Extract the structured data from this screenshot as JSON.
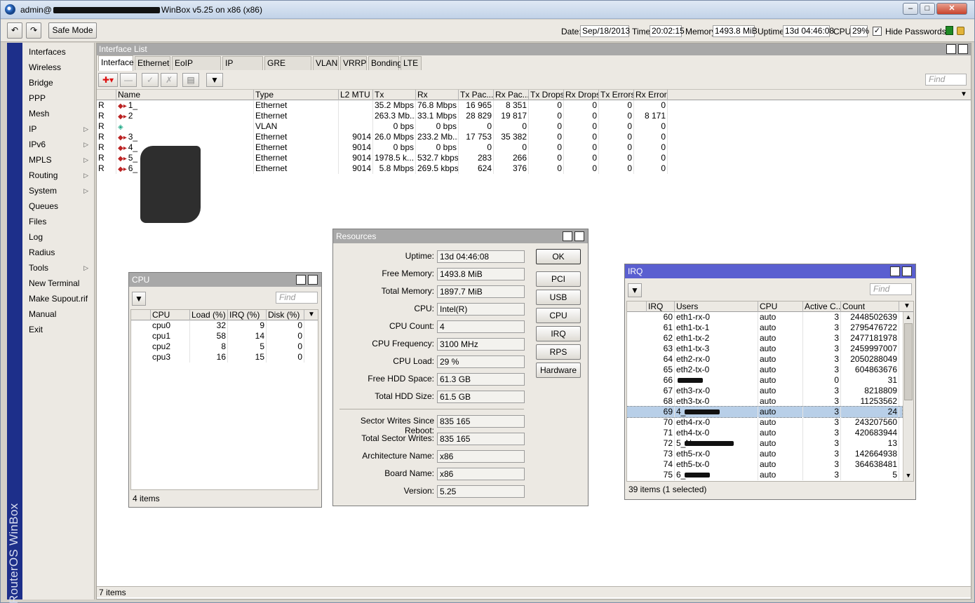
{
  "window": {
    "title_prefix": "admin@",
    "title_suffix": "WinBox v5.25 on x86 (x86)"
  },
  "toolbar": {
    "safe_mode": "Safe Mode",
    "date_label": "Date:",
    "date": "Sep/18/2013",
    "time_label": "Time:",
    "time": "20:02:15",
    "memory_label": "Memory:",
    "memory": "1493.8 MiB",
    "uptime_label": "Uptime:",
    "uptime": "13d 04:46:08",
    "cpu_label": "CPU:",
    "cpu": "29%",
    "hide_passwords": "Hide Passwords"
  },
  "brand": "RouterOS WinBox",
  "menu": [
    {
      "label": "Interfaces",
      "sub": false
    },
    {
      "label": "Wireless",
      "sub": false
    },
    {
      "label": "Bridge",
      "sub": false
    },
    {
      "label": "PPP",
      "sub": false
    },
    {
      "label": "Mesh",
      "sub": false
    },
    {
      "label": "IP",
      "sub": true
    },
    {
      "label": "IPv6",
      "sub": true
    },
    {
      "label": "MPLS",
      "sub": true
    },
    {
      "label": "Routing",
      "sub": true
    },
    {
      "label": "System",
      "sub": true
    },
    {
      "label": "Queues",
      "sub": false
    },
    {
      "label": "Files",
      "sub": false
    },
    {
      "label": "Log",
      "sub": false
    },
    {
      "label": "Radius",
      "sub": false
    },
    {
      "label": "Tools",
      "sub": true
    },
    {
      "label": "New Terminal",
      "sub": false
    },
    {
      "label": "Make Supout.rif",
      "sub": false
    },
    {
      "label": "Manual",
      "sub": false
    },
    {
      "label": "Exit",
      "sub": false
    }
  ],
  "interface_list": {
    "title": "Interface List",
    "tabs": [
      "Interface",
      "Ethernet",
      "EoIP Tunnel",
      "IP Tunnel",
      "GRE Tunnel",
      "VLAN",
      "VRRP",
      "Bonding",
      "LTE"
    ],
    "find": "Find",
    "columns": [
      "Name",
      "Type",
      "L2 MTU",
      "Tx",
      "Rx",
      "Tx Pac...",
      "Rx Pac...",
      "Tx Drops",
      "Rx Drops",
      "Tx Errors",
      "Rx Errors"
    ],
    "rows": [
      {
        "flag": "R",
        "name": "1_",
        "type": "Ethernet",
        "mtu": "",
        "tx": "35.2 Mbps",
        "rx": "76.8 Mbps",
        "txp": "16 965",
        "rxp": "8 351",
        "txd": "0",
        "rxd": "0",
        "txe": "0",
        "rxe": "0"
      },
      {
        "flag": "R",
        "name": "2",
        "type": "Ethernet",
        "mtu": "",
        "tx": "263.3 Mb...",
        "rx": "33.1 Mbps",
        "txp": "28 829",
        "rxp": "19 817",
        "txd": "0",
        "rxd": "0",
        "txe": "0",
        "rxe": "8 171"
      },
      {
        "flag": "R",
        "name": "",
        "type": "VLAN",
        "mtu": "",
        "tx": "0 bps",
        "rx": "0 bps",
        "txp": "0",
        "rxp": "0",
        "txd": "0",
        "rxd": "0",
        "txe": "0",
        "rxe": "0"
      },
      {
        "flag": "R",
        "name": "3_",
        "type": "Ethernet",
        "mtu": "9014",
        "tx": "26.0 Mbps",
        "rx": "233.2 Mb...",
        "txp": "17 753",
        "rxp": "35 382",
        "txd": "0",
        "rxd": "0",
        "txe": "0",
        "rxe": "0"
      },
      {
        "flag": "R",
        "name": "4_",
        "type": "Ethernet",
        "mtu": "9014",
        "tx": "0 bps",
        "rx": "0 bps",
        "txp": "0",
        "rxp": "0",
        "txd": "0",
        "rxd": "0",
        "txe": "0",
        "rxe": "0"
      },
      {
        "flag": "R",
        "name": "5_",
        "type": "Ethernet",
        "mtu": "9014",
        "tx": "1978.5 k...",
        "rx": "532.7 kbps",
        "txp": "283",
        "rxp": "266",
        "txd": "0",
        "rxd": "0",
        "txe": "0",
        "rxe": "0"
      },
      {
        "flag": "R",
        "name": "6_",
        "type": "Ethernet",
        "mtu": "9014",
        "tx": "5.8 Mbps",
        "rx": "269.5 kbps",
        "txp": "624",
        "rxp": "376",
        "txd": "0",
        "rxd": "0",
        "txe": "0",
        "rxe": "0"
      }
    ],
    "status": "7 items"
  },
  "cpu_window": {
    "title": "CPU",
    "find": "Find",
    "columns": [
      "CPU",
      "Load (%)",
      "IRQ (%)",
      "Disk (%)"
    ],
    "rows": [
      {
        "cpu": "cpu0",
        "load": "32",
        "irq": "9",
        "disk": "0"
      },
      {
        "cpu": "cpu1",
        "load": "58",
        "irq": "14",
        "disk": "0"
      },
      {
        "cpu": "cpu2",
        "load": "8",
        "irq": "5",
        "disk": "0"
      },
      {
        "cpu": "cpu3",
        "load": "16",
        "irq": "15",
        "disk": "0"
      }
    ],
    "status": "4 items"
  },
  "resources": {
    "title": "Resources",
    "fields": [
      {
        "label": "Uptime:",
        "value": "13d 04:46:08"
      },
      {
        "label": "Free Memory:",
        "value": "1493.8 MiB"
      },
      {
        "label": "Total Memory:",
        "value": "1897.7 MiB"
      },
      {
        "label": "CPU:",
        "value": "Intel(R)"
      },
      {
        "label": "CPU Count:",
        "value": "4"
      },
      {
        "label": "CPU Frequency:",
        "value": "3100 MHz"
      },
      {
        "label": "CPU Load:",
        "value": "29 %"
      },
      {
        "label": "Free HDD Space:",
        "value": "61.3 GB"
      },
      {
        "label": "Total HDD Size:",
        "value": "61.5 GB"
      },
      {
        "label": "Sector Writes Since Reboot:",
        "value": "835 165"
      },
      {
        "label": "Total Sector Writes:",
        "value": "835 165"
      },
      {
        "label": "Architecture Name:",
        "value": "x86"
      },
      {
        "label": "Board Name:",
        "value": "x86"
      },
      {
        "label": "Version:",
        "value": "5.25"
      }
    ],
    "buttons": [
      "OK",
      "PCI",
      "USB",
      "CPU",
      "IRQ",
      "RPS",
      "Hardware"
    ]
  },
  "irq_window": {
    "title": "IRQ",
    "find": "Find",
    "columns": [
      "IRQ",
      "Users",
      "CPU",
      "Active C...",
      "Count"
    ],
    "rows": [
      {
        "irq": "60",
        "users": "eth1-rx-0",
        "cpu": "auto",
        "active": "3",
        "count": "2448502639"
      },
      {
        "irq": "61",
        "users": "eth1-tx-1",
        "cpu": "auto",
        "active": "3",
        "count": "2795476722"
      },
      {
        "irq": "62",
        "users": "eth1-tx-2",
        "cpu": "auto",
        "active": "3",
        "count": "2477181978"
      },
      {
        "irq": "63",
        "users": "eth1-tx-3",
        "cpu": "auto",
        "active": "3",
        "count": "2459997007"
      },
      {
        "irq": "64",
        "users": "eth2-rx-0",
        "cpu": "auto",
        "active": "3",
        "count": "2050288049"
      },
      {
        "irq": "65",
        "users": "eth2-tx-0",
        "cpu": "auto",
        "active": "3",
        "count": "604863676"
      },
      {
        "irq": "66",
        "users": "",
        "cpu": "auto",
        "active": "0",
        "count": "31"
      },
      {
        "irq": "67",
        "users": "eth3-rx-0",
        "cpu": "auto",
        "active": "3",
        "count": "8218809"
      },
      {
        "irq": "68",
        "users": "eth3-tx-0",
        "cpu": "auto",
        "active": "3",
        "count": "11253562"
      },
      {
        "irq": "69",
        "users": "4_",
        "cpu": "auto",
        "active": "3",
        "count": "24"
      },
      {
        "irq": "70",
        "users": "eth4-rx-0",
        "cpu": "auto",
        "active": "3",
        "count": "243207560"
      },
      {
        "irq": "71",
        "users": "eth4-tx-0",
        "cpu": "auto",
        "active": "3",
        "count": "420683944"
      },
      {
        "irq": "72",
        "users": "5_N",
        "cpu": "auto",
        "active": "3",
        "count": "13"
      },
      {
        "irq": "73",
        "users": "eth5-rx-0",
        "cpu": "auto",
        "active": "3",
        "count": "142664938"
      },
      {
        "irq": "74",
        "users": "eth5-tx-0",
        "cpu": "auto",
        "active": "3",
        "count": "364638481"
      },
      {
        "irq": "75",
        "users": "6_",
        "cpu": "auto",
        "active": "3",
        "count": "5"
      }
    ],
    "selected_irq": "69",
    "status": "39 items (1 selected)"
  }
}
